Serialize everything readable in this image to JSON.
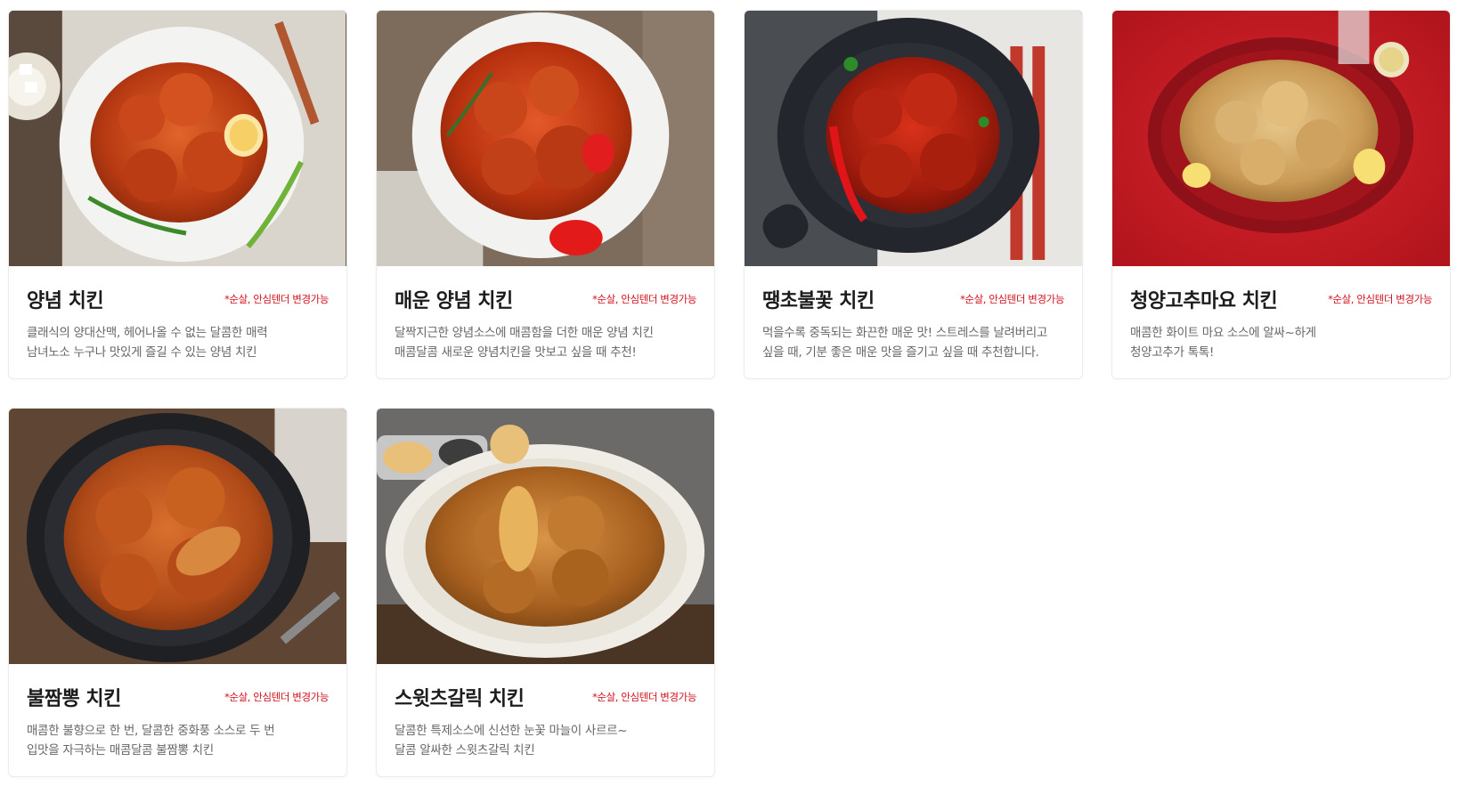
{
  "menu": {
    "items": [
      {
        "title": "양념 치킨",
        "note": "*순살, 안심텐더 변경가능",
        "desc_line1": "클래식의 양대산맥, 헤어나올 수 없는 달콤한 매력",
        "desc_line2": "남녀노소 누구나 맛있게 즐길 수 있는 양념 치킨",
        "image": "yangnyeom-chicken-photo"
      },
      {
        "title": "매운 양념 치킨",
        "note": "*순살, 안심텐더 변경가능",
        "desc_line1": "달짝지근한 양념소스에 매콤함을 더한 매운 양념 치킨",
        "desc_line2": "매콤달콤 새로운 양념치킨을 맛보고 싶을 때 추천!",
        "image": "spicy-yangnyeom-chicken-photo"
      },
      {
        "title": "땡초불꽃 치킨",
        "note": "*순살, 안심텐더 변경가능",
        "desc_line1": "먹을수록 중독되는 화끈한 매운 맛! 스트레스를 날려버리고",
        "desc_line2": "싶을 때, 기분 좋은 매운 맛을 즐기고 싶을 때 추천합니다.",
        "image": "ttaengcho-fire-chicken-photo"
      },
      {
        "title": "청양고추마요 치킨",
        "note": "*순살, 안심텐더 변경가능",
        "desc_line1": "매콤한 화이트 마요 소스에 알싸~하게",
        "desc_line2": "청양고추가 톡톡!",
        "image": "cheongyang-mayo-chicken-photo"
      },
      {
        "title": "불짬뽕 치킨",
        "note": "*순살, 안심텐더 변경가능",
        "desc_line1": "매콤한 불향으로 한 번, 달콤한 중화풍 소스로 두 번",
        "desc_line2": "입맛을 자극하는 매콤달콤 불짬뽕 치킨",
        "image": "buljjamppong-chicken-photo"
      },
      {
        "title": "스윗츠갈릭 치킨",
        "note": "*순살, 안심텐더 변경가능",
        "desc_line1": "달콤한 특제소스에 신선한 눈꽃 마늘이 사르르~",
        "desc_line2": "달콤 알싸한 스윗츠갈릭 치킨",
        "image": "sweets-garlic-chicken-photo"
      }
    ]
  },
  "colors": {
    "accent": "#d1121e",
    "title": "#1c1c1c",
    "desc": "#666666"
  }
}
